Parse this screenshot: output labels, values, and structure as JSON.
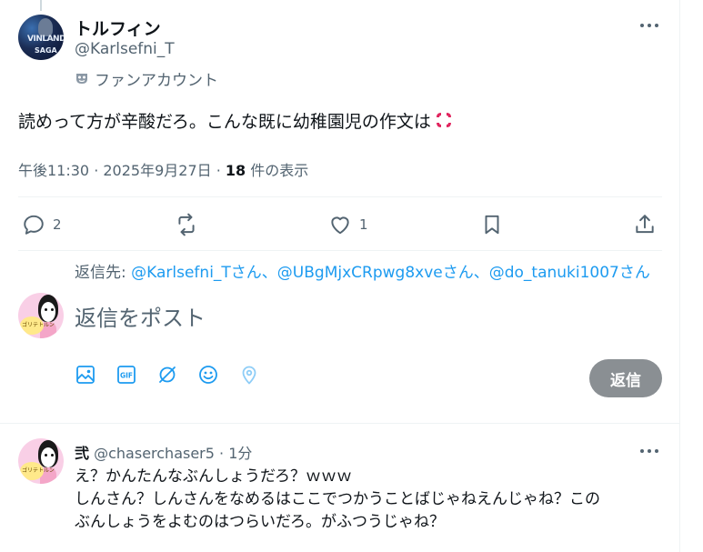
{
  "tweet": {
    "author_name": "トルフィン",
    "author_handle": "@Karlsefni_T",
    "avatar_text_1": "VINLAND",
    "avatar_text_2": "SAGA",
    "badge_label": "ファンアカウント",
    "text": "読めって方が辛酸だろ。こんな既に幼稚園児の作文は",
    "emoji": "anger-symbol",
    "time": "午後11:30 · 2025年9月27日 · ",
    "views_count": "18",
    "views_label": " 件の表示"
  },
  "actions": {
    "reply_count": "2",
    "like_count": "1"
  },
  "reply_to": {
    "prefix": "返信先: ",
    "mentions": "@Karlsefni_Tさん、@UBgMjxCRpwg8xveさん、@do_tanuki1007さん"
  },
  "composer": {
    "placeholder": "返信をポスト",
    "avatar_text": "ゴリテトルン",
    "submit_label": "返信"
  },
  "reply": {
    "name": "弐",
    "handle": "@chaserchaser5",
    "time_sep": " · ",
    "time": "1分",
    "avatar_text": "ゴリテトルン",
    "lines": [
      "え？かんたんなぶんしょうだろ？ｗｗｗ",
      "しんさん？しんさんをなめるはここでつかうことばじゃねえんじゃね？この",
      "ぶんしょうをよむのはつらいだろ。がふつうじゃね？"
    ]
  },
  "colors": {
    "accent": "#1d9bf0",
    "muted": "#536471",
    "button_disabled": "#8a8f93"
  }
}
